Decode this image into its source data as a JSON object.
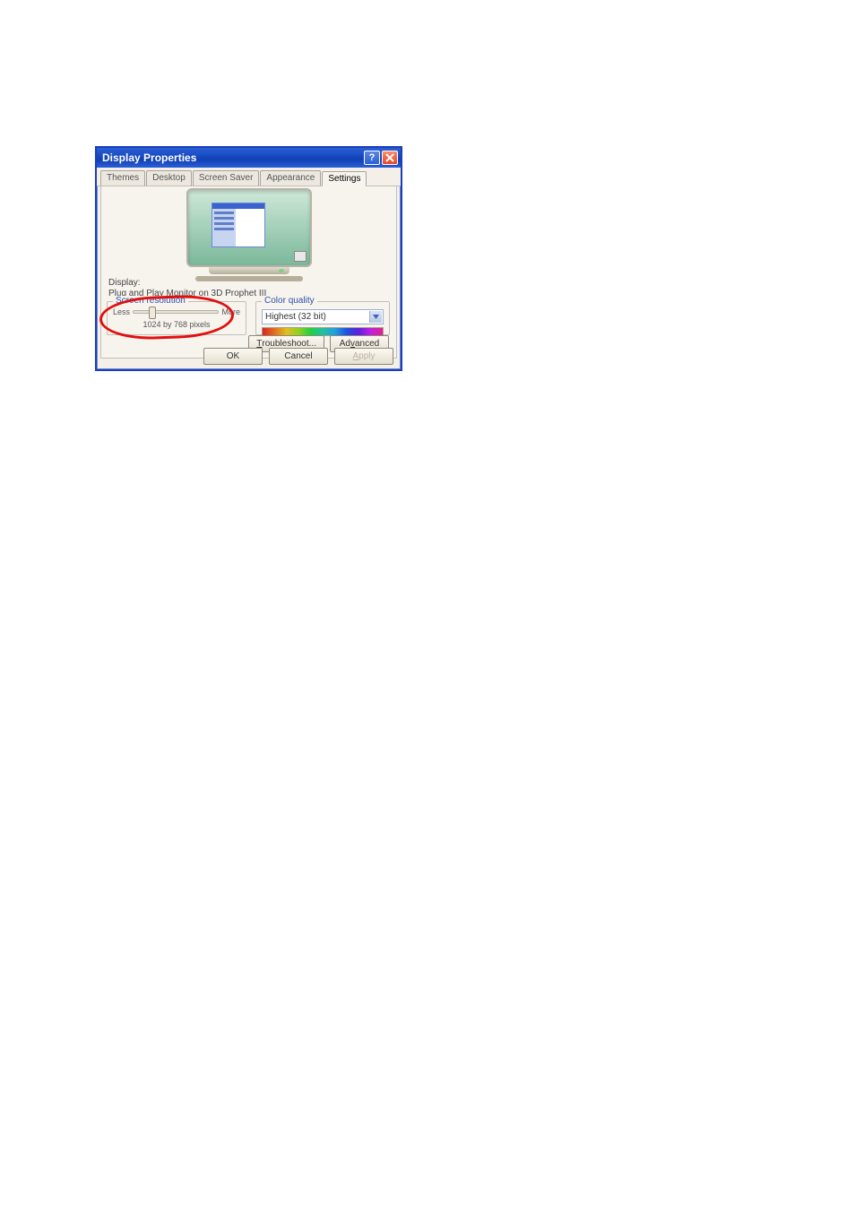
{
  "window": {
    "title": "Display Properties"
  },
  "tabs": {
    "themes": "Themes",
    "desktop": "Desktop",
    "screensaver": "Screen Saver",
    "appearance": "Appearance",
    "settings": "Settings"
  },
  "display": {
    "label": "Display:",
    "value_pre": "Plug and Play ",
    "value_ul": "M",
    "value_post": "onitor on 3D Prophet III"
  },
  "screen_resolution": {
    "legend_pre": "S",
    "legend_ul": "c",
    "legend_post": "reen resolution",
    "less": "Less",
    "more": "More",
    "value": "1024 by 768 pixels",
    "slider_percent": 18
  },
  "color_quality": {
    "legend_ul": "C",
    "legend_post": "olor quality",
    "selected": "Highest (32 bit)"
  },
  "buttons": {
    "troubleshoot_ul": "T",
    "troubleshoot_post": "roubleshoot...",
    "advanced_pre": "Ad",
    "advanced_ul": "v",
    "advanced_post": "anced",
    "ok": "OK",
    "cancel": "Cancel",
    "apply_ul": "A",
    "apply_post": "pply"
  }
}
